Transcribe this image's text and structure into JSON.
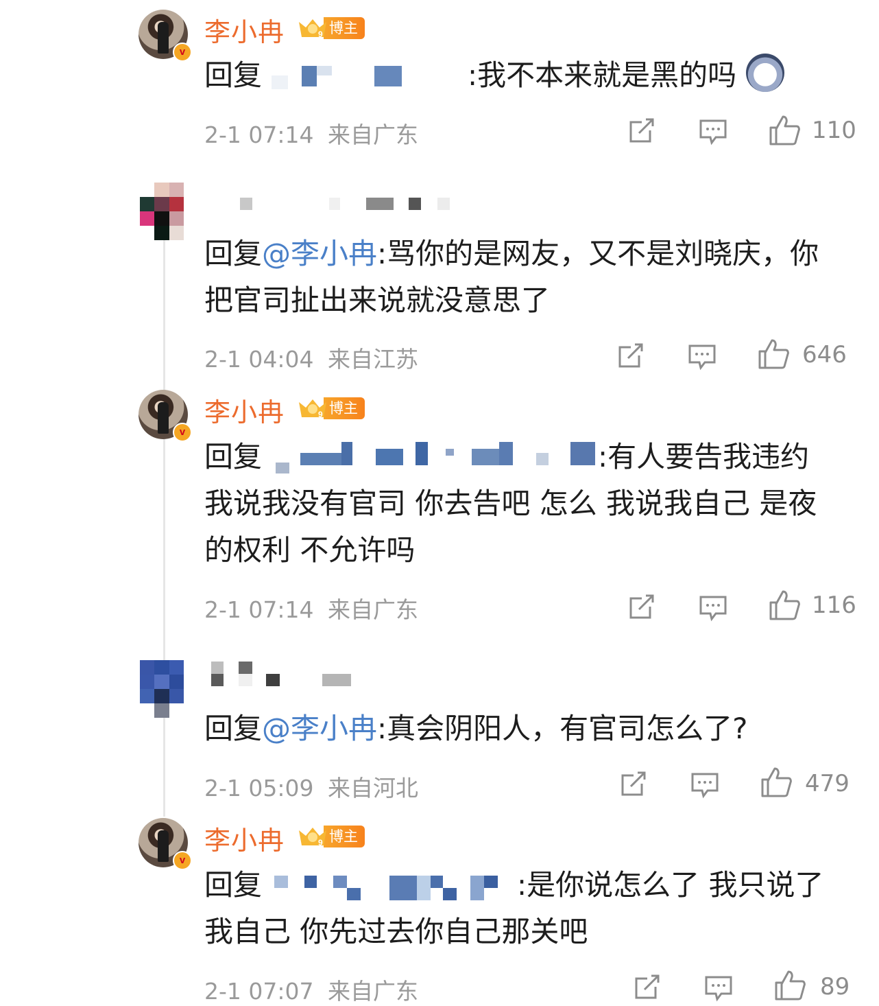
{
  "comments": [
    {
      "author": "李小冉",
      "badge": "博主",
      "reply_prefix": "回复",
      "text": ":我不本来就是黑的吗",
      "time": "2-1 07:14",
      "location": "来自广东",
      "likes": "110"
    },
    {
      "author": "",
      "reply_prefix": "回复",
      "mention": "@李小冉",
      "text": ":骂你的是网友，又不是刘晓庆，你把官司扯出来说就没意思了",
      "time": "2-1 04:04",
      "location": "来自江苏",
      "likes": "646"
    },
    {
      "author": "李小冉",
      "badge": "博主",
      "reply_prefix": "回复",
      "text": ":有人要告我违约 我说我没有官司 你去告吧 怎么 我说我自己 是夜的权利 不允许吗",
      "time": "2-1 07:14",
      "location": "来自广东",
      "likes": "116"
    },
    {
      "author": "",
      "reply_prefix": "回复",
      "mention": "@李小冉",
      "text": ":真会阴阳人，有官司怎么了?",
      "time": "2-1 05:09",
      "location": "来自河北",
      "likes": "479"
    },
    {
      "author": "李小冉",
      "badge": "博主",
      "reply_prefix": "回复",
      "text": ":是你说怎么了 我只说了我自己 你先过去你自己那关吧",
      "time": "2-1 07:07",
      "location": "来自广东",
      "likes": "89"
    }
  ],
  "icons": {
    "verified": "v",
    "share": "share-icon",
    "comment": "comment-icon",
    "like": "thumbs-up-icon",
    "crown_level": "9"
  },
  "colors": {
    "author": "#ec6b2d",
    "mention": "#4a80c8",
    "meta": "#9a9a9a",
    "badge": "#f7a52b"
  }
}
